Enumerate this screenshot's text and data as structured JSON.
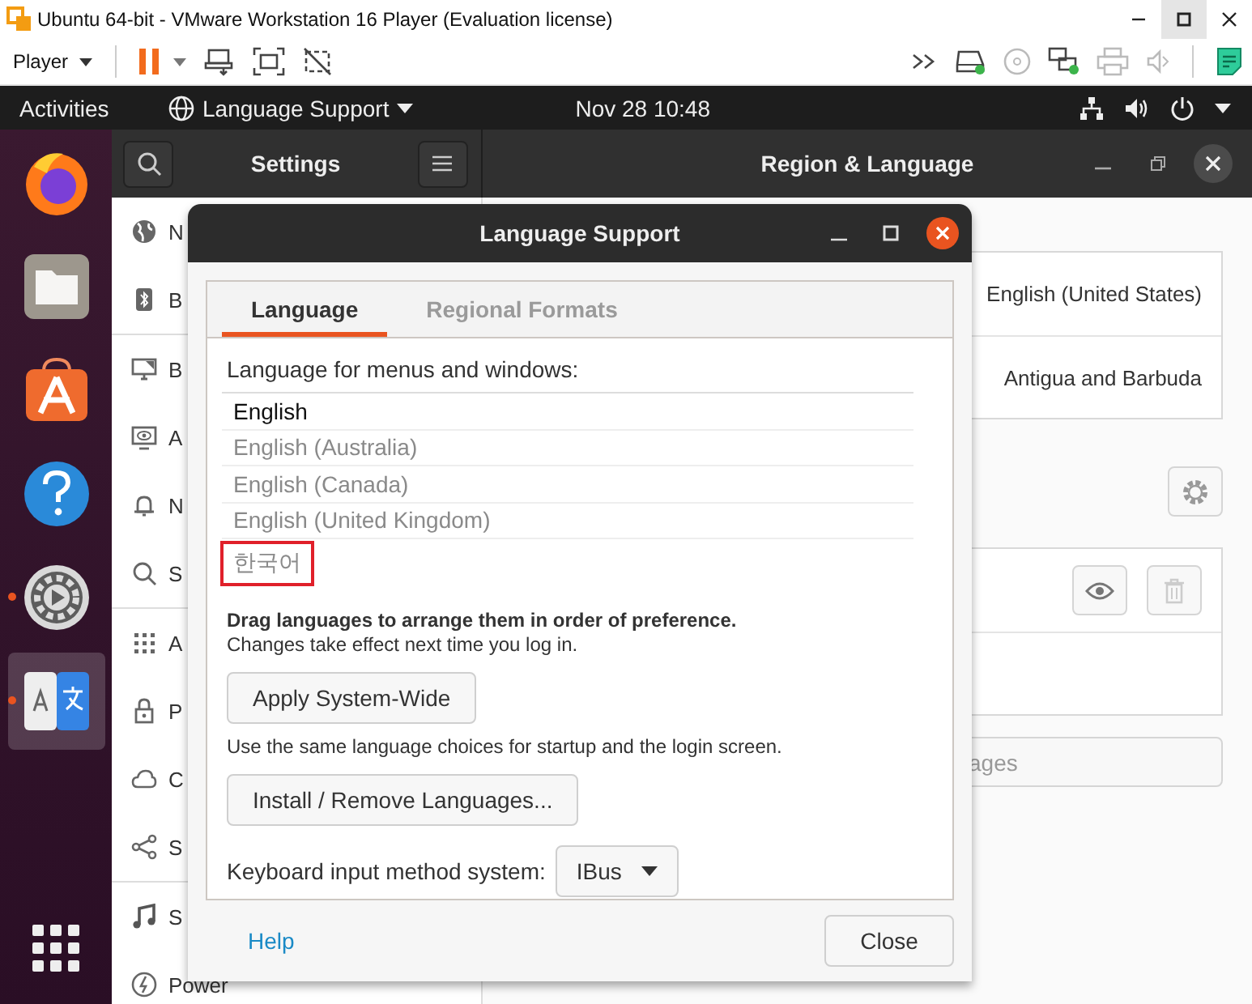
{
  "vm_window": {
    "title": "Ubuntu 64-bit - VMware Workstation 16 Player (Evaluation license)",
    "player_menu": "Player"
  },
  "top_bar": {
    "activities": "Activities",
    "app_menu": "Language Support",
    "clock": "Nov 28  10:48"
  },
  "dock": [
    {
      "kind": "browser",
      "running": false,
      "selected": false
    },
    {
      "kind": "files",
      "running": false,
      "selected": false
    },
    {
      "kind": "store",
      "running": false,
      "selected": false
    },
    {
      "kind": "help",
      "running": false,
      "selected": false
    },
    {
      "kind": "settings",
      "running": true,
      "selected": false
    },
    {
      "kind": "language",
      "running": true,
      "selected": true
    },
    {
      "kind": "apps",
      "running": false,
      "selected": false
    }
  ],
  "settings_window": {
    "title": "Settings",
    "panel_title": "Region & Language",
    "sidebar": [
      {
        "items": [
          {
            "kind": "globe",
            "label": "N"
          },
          {
            "kind": "bluetooth",
            "label": "B"
          }
        ]
      },
      {
        "items": [
          {
            "kind": "display",
            "label": "B"
          },
          {
            "kind": "screen",
            "label": "A"
          },
          {
            "kind": "bell",
            "label": "N"
          },
          {
            "kind": "search",
            "label": "S"
          }
        ]
      },
      {
        "items": [
          {
            "kind": "grid",
            "label": "A"
          },
          {
            "kind": "lock",
            "label": "P"
          },
          {
            "kind": "cloud",
            "label": "C"
          },
          {
            "kind": "share",
            "label": "S"
          }
        ]
      },
      {
        "items": [
          {
            "kind": "music",
            "label": "S"
          },
          {
            "kind": "power",
            "label": "Power"
          }
        ]
      }
    ],
    "region_rows": [
      "English (United States)",
      "Antigua and Barbuda"
    ],
    "manage_button": "ages"
  },
  "dialog": {
    "title": "Language Support",
    "tabs": [
      {
        "label": "Language",
        "selected": true
      },
      {
        "label": "Regional Formats",
        "selected": false
      }
    ],
    "list_label": "Language for menus and windows:",
    "languages": [
      {
        "label": "English",
        "disabled": false,
        "highlighted": false
      },
      {
        "label": "English (Australia)",
        "disabled": true,
        "highlighted": false
      },
      {
        "label": "English (Canada)",
        "disabled": true,
        "highlighted": false
      },
      {
        "label": "English (United Kingdom)",
        "disabled": true,
        "highlighted": false
      },
      {
        "label": "한국어",
        "disabled": true,
        "highlighted": true
      }
    ],
    "hint": "Drag languages to arrange them in order of preference.",
    "note": "Changes take effect next time you log in.",
    "apply_button": "Apply System-Wide",
    "apply_note": "Use the same language choices for startup and the login screen.",
    "install_button": "Install / Remove Languages...",
    "input_label": "Keyboard input method system:",
    "input_method": "IBus",
    "help_link": "Help",
    "close_button": "Close"
  }
}
